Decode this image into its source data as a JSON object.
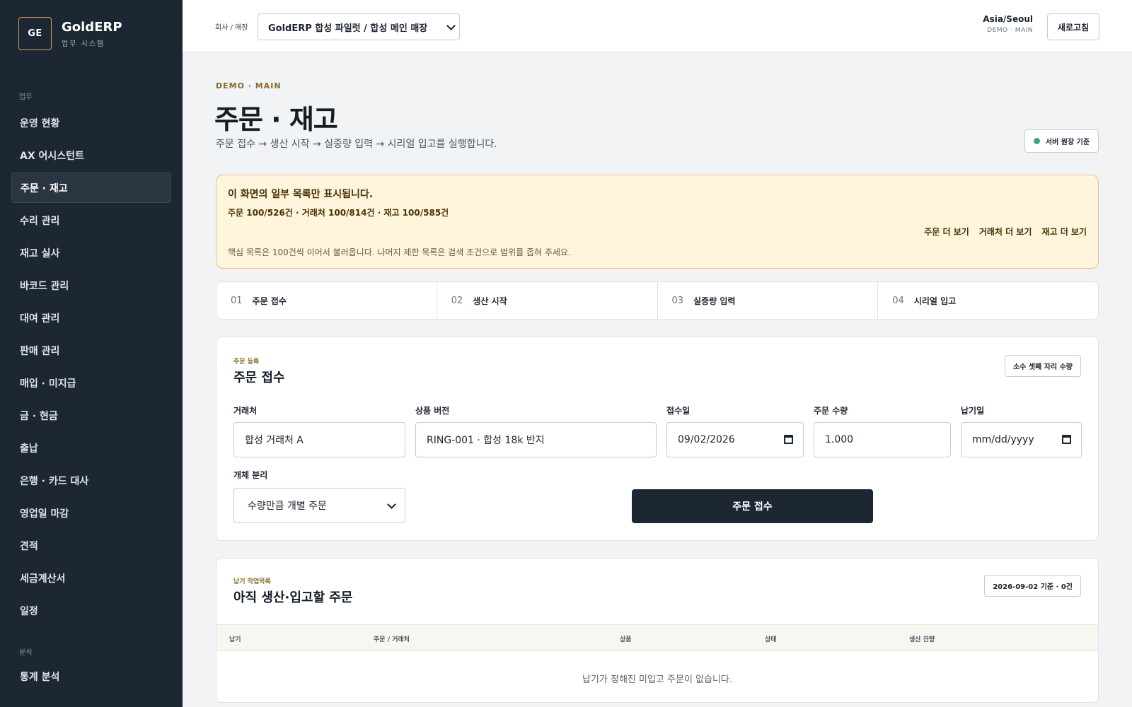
{
  "brand": {
    "logo": "GE",
    "name": "GoldERP",
    "subtitle": "업무 시스템"
  },
  "sidebar": {
    "section_work": "업무",
    "section_analysis": "분석",
    "items": [
      {
        "label": "운영 현황"
      },
      {
        "label": "AX 어시스턴트"
      },
      {
        "label": "주문 · 재고",
        "active": true
      },
      {
        "label": "수리 관리"
      },
      {
        "label": "재고 실사"
      },
      {
        "label": "바코드 관리"
      },
      {
        "label": "대여 관리"
      },
      {
        "label": "판매 관리"
      },
      {
        "label": "매입 · 미지급"
      },
      {
        "label": "금 · 현금"
      },
      {
        "label": "출납"
      },
      {
        "label": "은행 · 카드 대사"
      },
      {
        "label": "영업일 마감"
      },
      {
        "label": "견적"
      },
      {
        "label": "세금계산서"
      },
      {
        "label": "일정"
      }
    ],
    "analysis_items": [
      {
        "label": "통계 분석"
      }
    ]
  },
  "topbar": {
    "company_label": "회사 / 매장",
    "company_value": "GoldERP 합성 파일럿 / 합성 메인 매장",
    "timezone": "Asia/Seoul",
    "timezone_sub": "DEMO · MAIN",
    "refresh_label": "새로고침"
  },
  "page": {
    "eyebrow": "DEMO · MAIN",
    "title": "주문 · 재고",
    "description": "주문 접수 → 생산 시작 → 실중량 입력 → 시리얼 입고를 실행합니다.",
    "server_badge": "서버 원장 기준"
  },
  "notice": {
    "title": "이 화면의 일부 목록만 표시됩니다.",
    "counts": "주문 100/526건 · 거래처 100/814건 · 재고 100/585건",
    "links": [
      "주문 더 보기",
      "거래처 더 보기",
      "재고 더 보기"
    ],
    "note": "핵심 목록은 100건씩 이어서 불러옵니다. 나머지 제한 목록은 검색 조건으로 범위를 좁혀 주세요."
  },
  "steps": [
    {
      "num": "01",
      "label": "주문 접수"
    },
    {
      "num": "02",
      "label": "생산 시작"
    },
    {
      "num": "03",
      "label": "실중량 입력"
    },
    {
      "num": "04",
      "label": "시리얼 입고"
    }
  ],
  "order_form": {
    "eyebrow": "주문 등록",
    "title": "주문 접수",
    "decimal_chip": "소수 셋째 자리 수량",
    "client_label": "거래처",
    "client_value": "합성 거래처 A",
    "product_label": "상품 버전",
    "product_value": "RING-001 · 합성 18k 반지",
    "received_label": "접수일",
    "received_value": "09/02/2026",
    "qty_label": "주문 수량",
    "qty_value": "1.000",
    "due_label": "납기일",
    "due_placeholder": "mm/dd/yyyy",
    "split_label": "개체 분리",
    "split_value": "수량만큼 개별 주문",
    "submit_label": "주문 접수"
  },
  "due_list": {
    "eyebrow": "납기 작업목록",
    "title": "아직 생산·입고할 주문",
    "chip": "2026-09-02 기준 · 0건",
    "columns": [
      "납기",
      "주문 / 거래처",
      "상품",
      "상태",
      "생산 잔량"
    ],
    "empty": "납기가 정해진 미입고 주문이 없습니다."
  }
}
